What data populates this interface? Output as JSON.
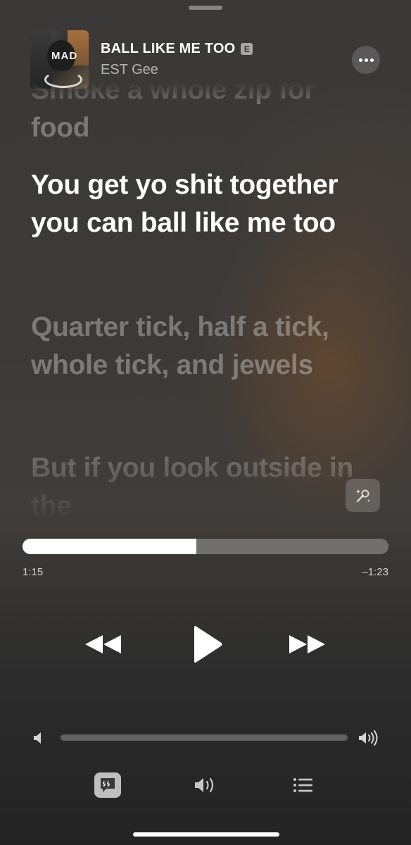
{
  "now_playing": {
    "title": "BALL LIKE ME TOO",
    "explicit_badge": "E",
    "artist": "EST Gee",
    "album_art_text": "MAD"
  },
  "menu": {
    "icon": "more-icon"
  },
  "lyrics": {
    "lines": [
      {
        "text": "Smoke a whole zip for food",
        "state": "past"
      },
      {
        "text": "You get yo shit together you can ball like me too",
        "state": "current"
      },
      {
        "text": "Quarter tick, half a tick, whole tick, and jewels",
        "state": "upcoming"
      },
      {
        "text": "But if you look outside in the",
        "state": "upcoming"
      }
    ],
    "sing_icon": "microphone-sparkle-icon"
  },
  "playback": {
    "elapsed": "1:15",
    "remaining": "–1:23",
    "progress_fraction": 0.475
  },
  "controls": {
    "rewind_icon": "rewind-icon",
    "play_icon": "play-icon",
    "forward_icon": "fast-forward-icon"
  },
  "volume": {
    "level_fraction": 0.0,
    "low_icon": "speaker-low-icon",
    "high_icon": "speaker-high-icon"
  },
  "bottom_bar": {
    "lyrics_icon": "lyrics-quote-icon",
    "airplay_icon": "speaker-output-icon",
    "queue_icon": "queue-list-icon"
  },
  "colors": {
    "background": "#3a3938",
    "accent_text": "#ffffff",
    "dim_text": "rgba(255,255,255,0.32)"
  }
}
